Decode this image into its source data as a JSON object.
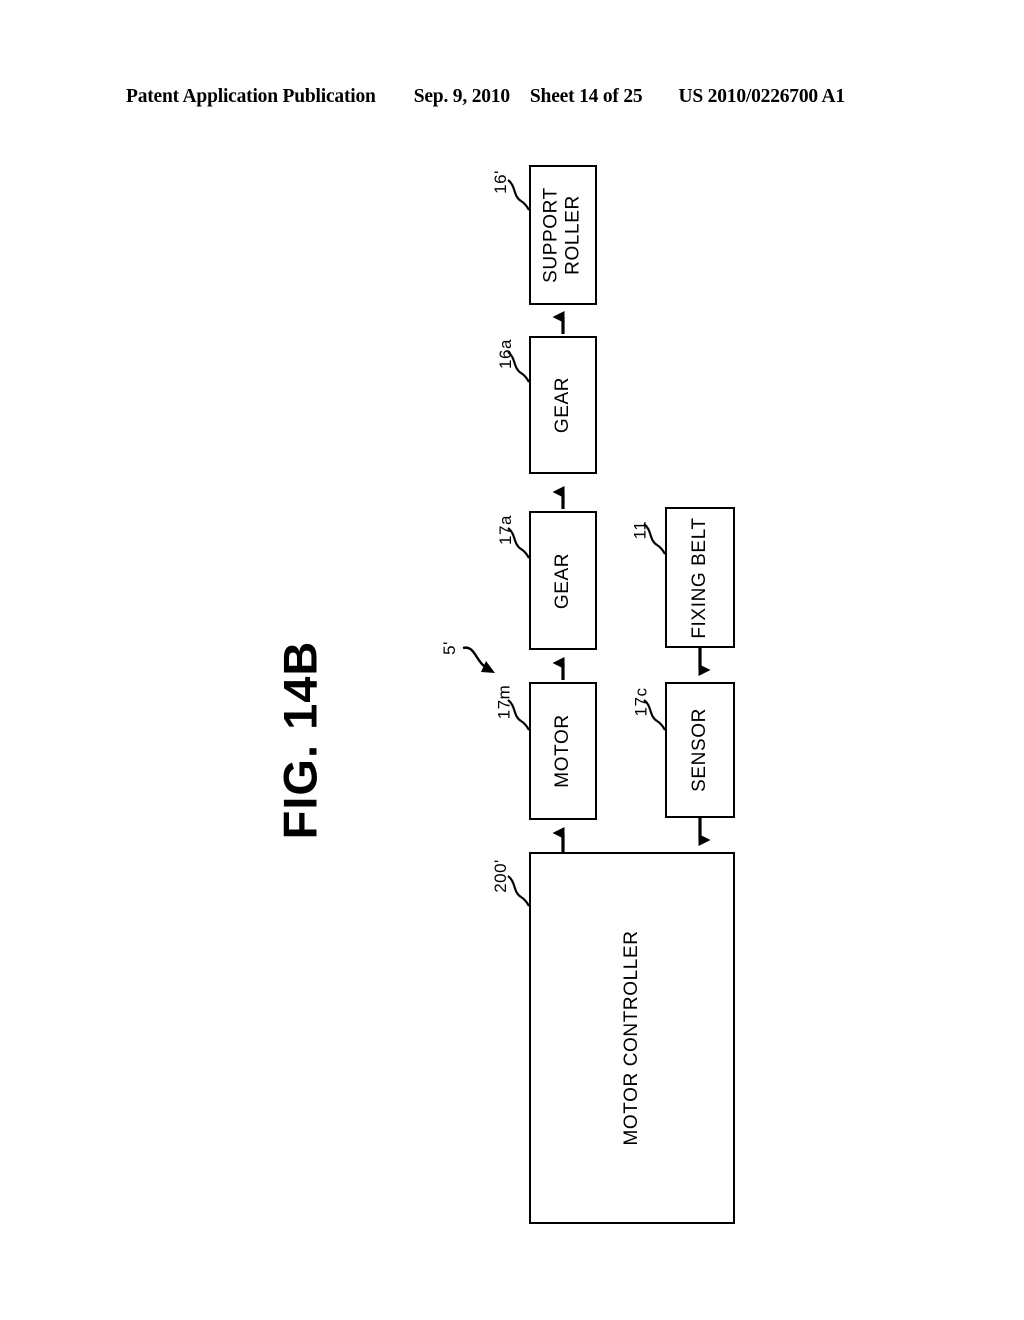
{
  "header": {
    "publication": "Patent Application Publication",
    "date": "Sep. 9, 2010",
    "sheet": "Sheet 14 of 25",
    "publication_number": "US 2010/0226700 A1"
  },
  "figure": {
    "title": "FIG. 14B",
    "assembly_ref": "5'"
  },
  "blocks": [
    {
      "id": "support-roller",
      "label": "SUPPORT\nROLLER",
      "ref": "16'"
    },
    {
      "id": "gear-16a",
      "label": "GEAR",
      "ref": "16a"
    },
    {
      "id": "gear-17a",
      "label": "GEAR",
      "ref": "17a"
    },
    {
      "id": "motor",
      "label": "MOTOR",
      "ref": "17m"
    },
    {
      "id": "fixing-belt",
      "label": "FIXING BELT",
      "ref": "11"
    },
    {
      "id": "sensor",
      "label": "SENSOR",
      "ref": "17c"
    },
    {
      "id": "motor-controller",
      "label": "MOTOR CONTROLLER",
      "ref": "200'"
    }
  ],
  "connections": [
    {
      "from": "gear-16a",
      "to": "support-roller",
      "direction": "up"
    },
    {
      "from": "gear-17a",
      "to": "gear-16a",
      "direction": "up"
    },
    {
      "from": "motor",
      "to": "gear-17a",
      "direction": "up"
    },
    {
      "from": "motor-controller",
      "to": "motor",
      "direction": "up"
    },
    {
      "from": "fixing-belt",
      "to": "sensor",
      "direction": "down"
    },
    {
      "from": "sensor",
      "to": "motor-controller",
      "direction": "down"
    }
  ],
  "colors": {
    "ink": "#000000",
    "paper": "#ffffff"
  }
}
